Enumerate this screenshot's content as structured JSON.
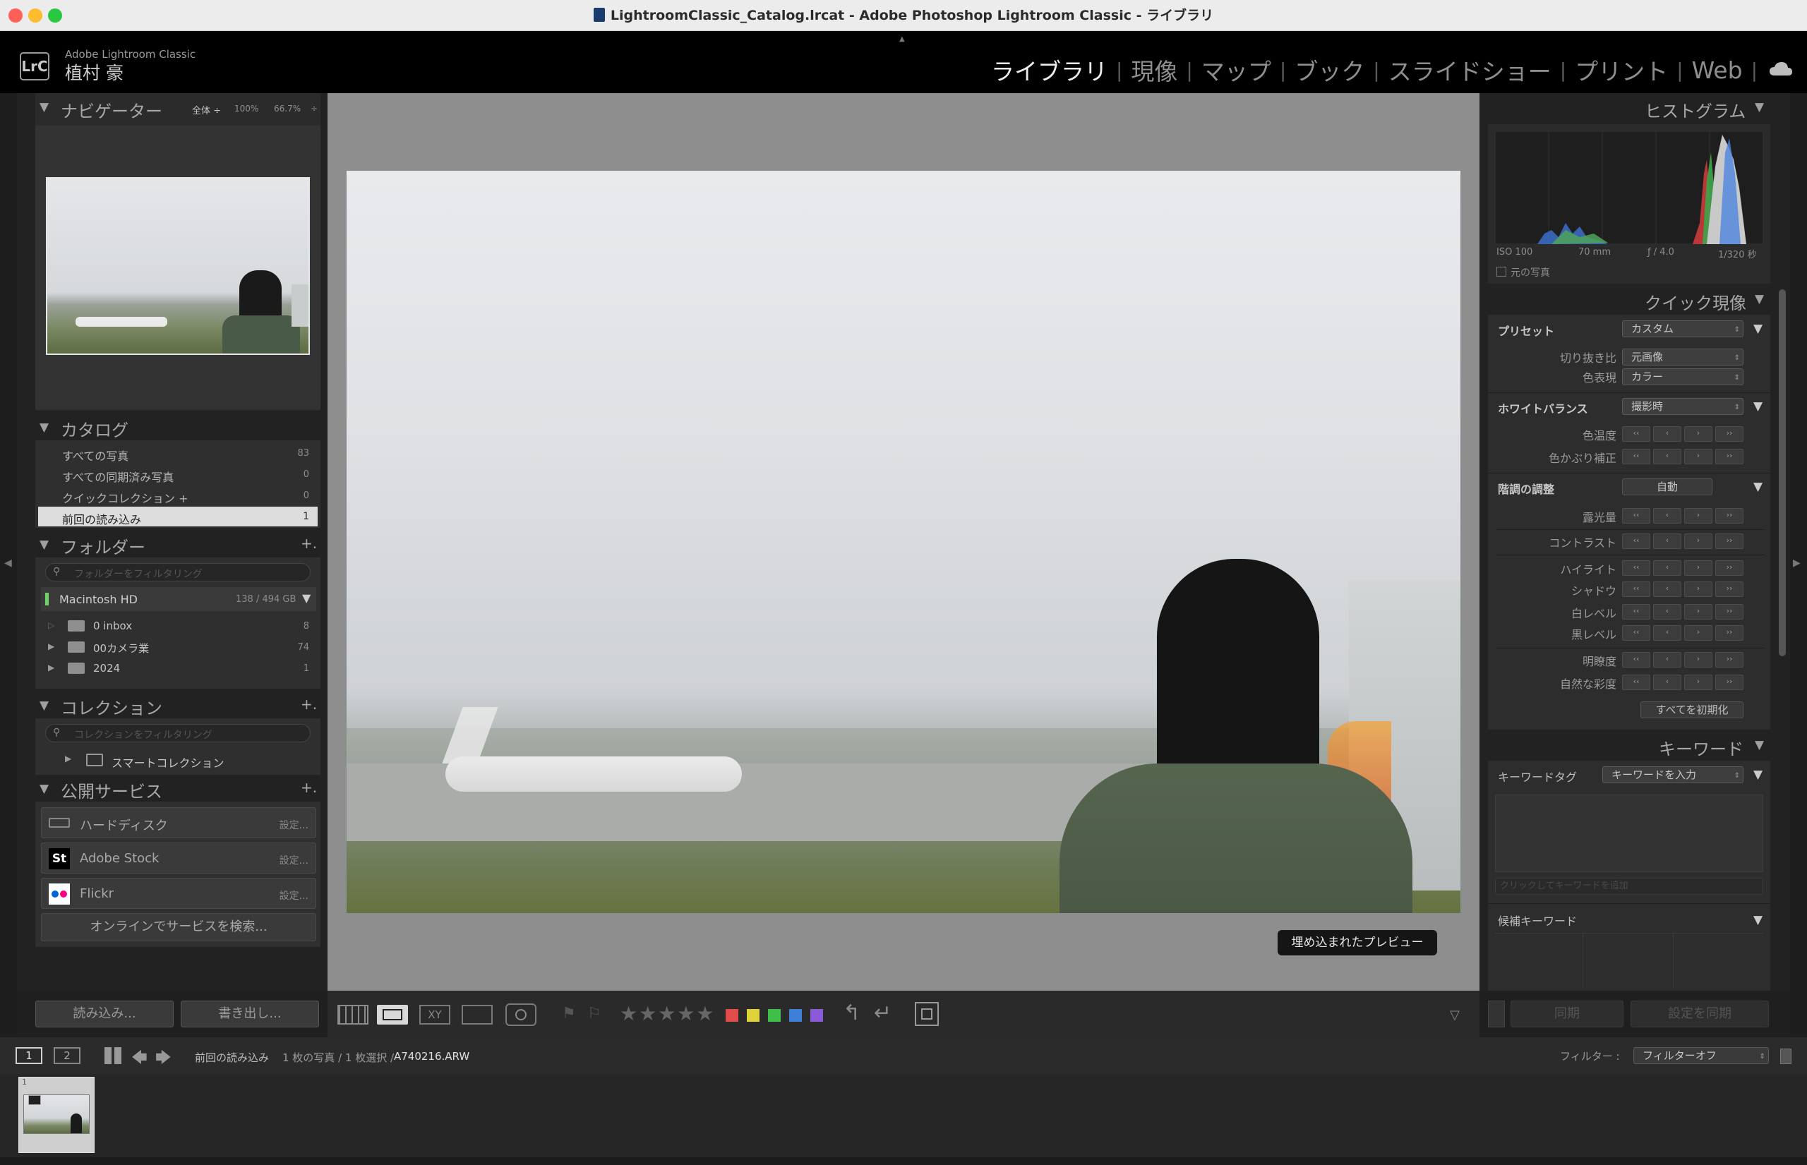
{
  "window": {
    "title": "LightroomClassic_Catalog.lrcat - Adobe Photoshop Lightroom Classic - ライブラリ",
    "colors": {
      "close": "#fe5f57",
      "minimize": "#febc2e",
      "zoom": "#28c840"
    }
  },
  "header": {
    "logo": "LrC",
    "app_name": "Adobe Lightroom Classic",
    "user_name": "植村 豪",
    "modules": [
      "ライブラリ",
      "現像",
      "マップ",
      "ブック",
      "スライドショー",
      "プリント",
      "Web"
    ],
    "separator": "|",
    "active_module": "ライブラリ"
  },
  "navigator": {
    "title": "ナビゲーター",
    "zoom_fit": "全体 ÷",
    "zoom_100": "100%",
    "zoom_667": "66.7%",
    "zoom_arrow": "÷"
  },
  "catalog": {
    "title": "カタログ",
    "items": [
      {
        "label": "すべての写真",
        "count": "83"
      },
      {
        "label": "すべての同期済み写真",
        "count": "0"
      },
      {
        "label": "クイックコレクション +",
        "count": "0"
      },
      {
        "label": "前回の読み込み",
        "count": "1"
      }
    ]
  },
  "folders": {
    "title": "フォルダー",
    "add": "+.",
    "filter_placeholder": "フォルダーをフィルタリング",
    "volume": {
      "name": "Macintosh HD",
      "space": "138 / 494 GB"
    },
    "items": [
      {
        "name": "0 inbox",
        "count": "8"
      },
      {
        "name": "00カメラ業",
        "count": "74"
      },
      {
        "name": "2024",
        "count": "1"
      }
    ]
  },
  "collections": {
    "title": "コレクション",
    "add": "+.",
    "filter_placeholder": "コレクションをフィルタリング",
    "smart": "スマートコレクション"
  },
  "publish": {
    "title": "公開サービス",
    "add": "+.",
    "services": [
      {
        "name": "ハードディスク",
        "action": "設定..."
      },
      {
        "name": "Adobe Stock",
        "action": "設定..."
      },
      {
        "name": "Flickr",
        "action": "設定..."
      }
    ],
    "find_more": "オンラインでサービスを検索..."
  },
  "left_buttons": {
    "import": "読み込み...",
    "export": "書き出し..."
  },
  "center": {
    "preview_badge": "埋め込まれたプレビュー",
    "toolbar": {
      "stars": "★★★★★",
      "labels": [
        "#e04b4b",
        "#e0d23a",
        "#3fbf4a",
        "#3f7fd9",
        "#8a5ad9"
      ]
    }
  },
  "histogram": {
    "title": "ヒストグラム",
    "iso": "ISO 100",
    "focal": "70 mm",
    "aperture": "ƒ / 4.0",
    "shutter": "1/320 秒",
    "original_photo": "元の写真"
  },
  "quick_develop": {
    "title": "クイック現像",
    "preset_label": "プリセット",
    "preset_value": "カスタム",
    "crop_label": "切り抜き比",
    "crop_value": "元画像",
    "treatment_label": "色表現",
    "treatment_value": "カラー",
    "wb_label": "ホワイトバランス",
    "wb_value": "撮影時",
    "temp_label": "色温度",
    "tint_label": "色かぶり補正",
    "tone_label": "階調の調整",
    "auto_button": "自動",
    "exposure_label": "露光量",
    "contrast_label": "コントラスト",
    "highlights_label": "ハイライト",
    "shadows_label": "シャドウ",
    "whites_label": "白レベル",
    "blacks_label": "黒レベル",
    "clarity_label": "明瞭度",
    "vibrance_label": "自然な彩度",
    "reset_all": "すべてを初期化"
  },
  "keywords": {
    "title": "キーワード",
    "tag_label": "キーワードタグ",
    "tag_value": "キーワードを入力",
    "add_placeholder": "クリックしてキーワードを追加",
    "suggestions": "候補キーワード"
  },
  "right_buttons": {
    "sync": "同期",
    "sync_settings": "設定を同期"
  },
  "filmstrip_bar": {
    "screen1": "1",
    "screen2": "2",
    "source": "前回の読み込み",
    "count": "1 枚の写真 / 1 枚選択 /",
    "filename": "A740216.ARW",
    "filter_label": "フィルター :",
    "filter_value": "フィルターオフ"
  },
  "filmstrip": {
    "thumb_index": "1"
  }
}
